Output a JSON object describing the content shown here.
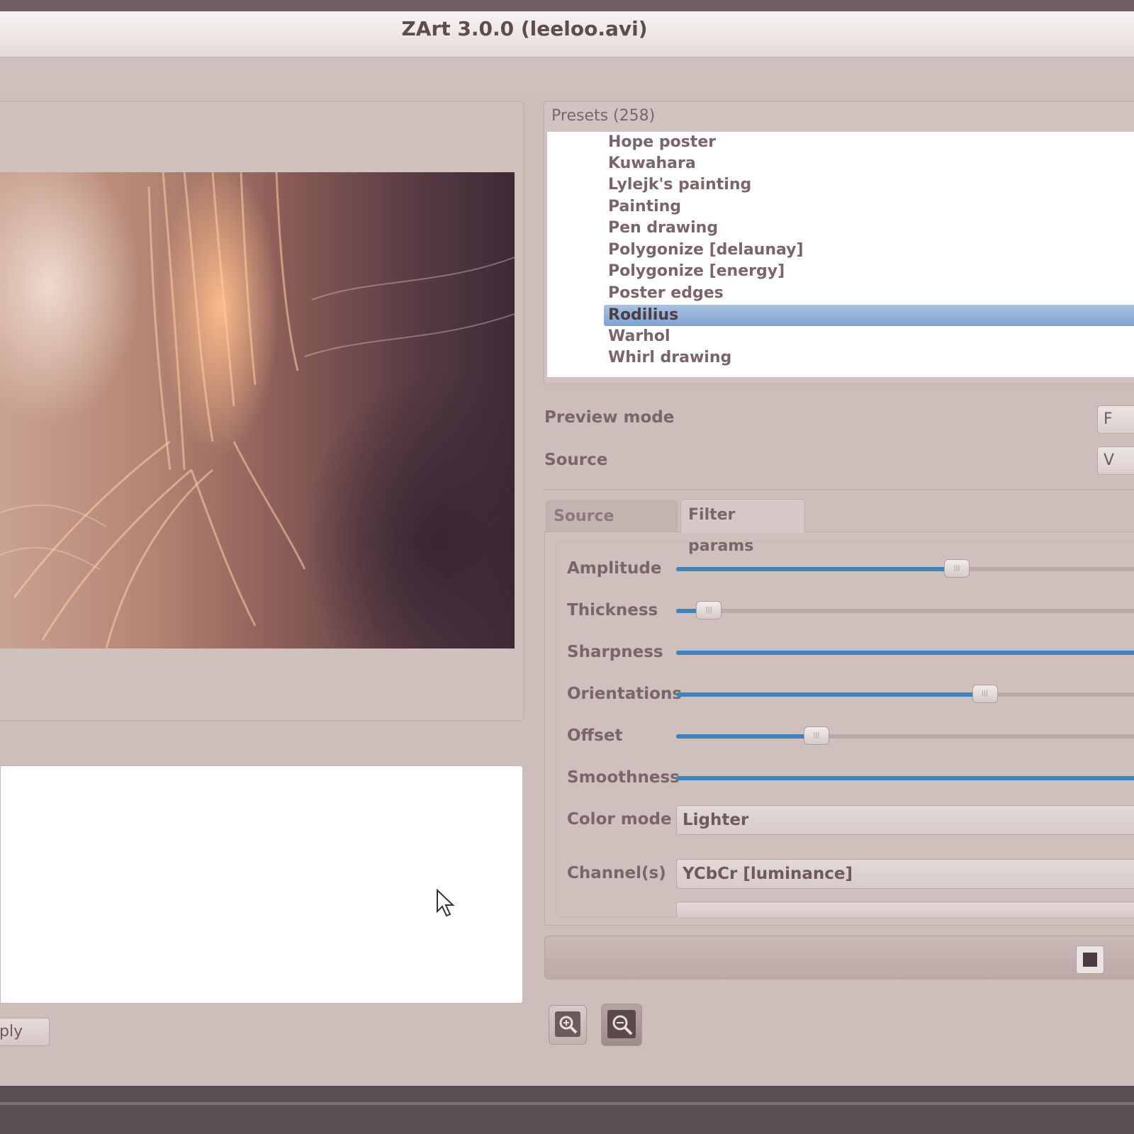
{
  "window": {
    "title": "ZArt 3.0.0 (leeloo.avi)"
  },
  "presets": {
    "header": "Presets (258)",
    "items": [
      "Hope poster",
      "Kuwahara",
      "Lylejk's painting",
      "Painting",
      "Pen drawing",
      "Polygonize [delaunay]",
      "Polygonize [energy]",
      "Poster edges",
      "Rodilius",
      "Warhol",
      "Whirl drawing"
    ],
    "selected": "Rodilius"
  },
  "form": {
    "preview_mode_label": "Preview mode",
    "preview_mode_value": "F",
    "source_label": "Source",
    "source_value": "V"
  },
  "tabs": {
    "source": "Source params",
    "filter": "Filter params"
  },
  "params": [
    {
      "label": "Amplitude",
      "fraction": 0.6
    },
    {
      "label": "Thickness",
      "fraction": 0.07
    },
    {
      "label": "Sharpness",
      "fraction": 1.0
    },
    {
      "label": "Orientations",
      "fraction": 0.66
    },
    {
      "label": "Offset",
      "fraction": 0.3
    },
    {
      "label": "Smoothness",
      "fraction": 1.0
    }
  ],
  "color_mode": {
    "label": "Color mode",
    "value": "Lighter"
  },
  "channels": {
    "label": "Channel(s)",
    "value": "YCbCr [luminance]"
  },
  "apply_button": "ply",
  "colors": {
    "accent": "#3d84bd",
    "selection": "#8fb0da",
    "background": "#cdbdbb"
  },
  "icons": {
    "zoom_in": "zoom-in-icon",
    "zoom_out": "zoom-out-icon"
  }
}
